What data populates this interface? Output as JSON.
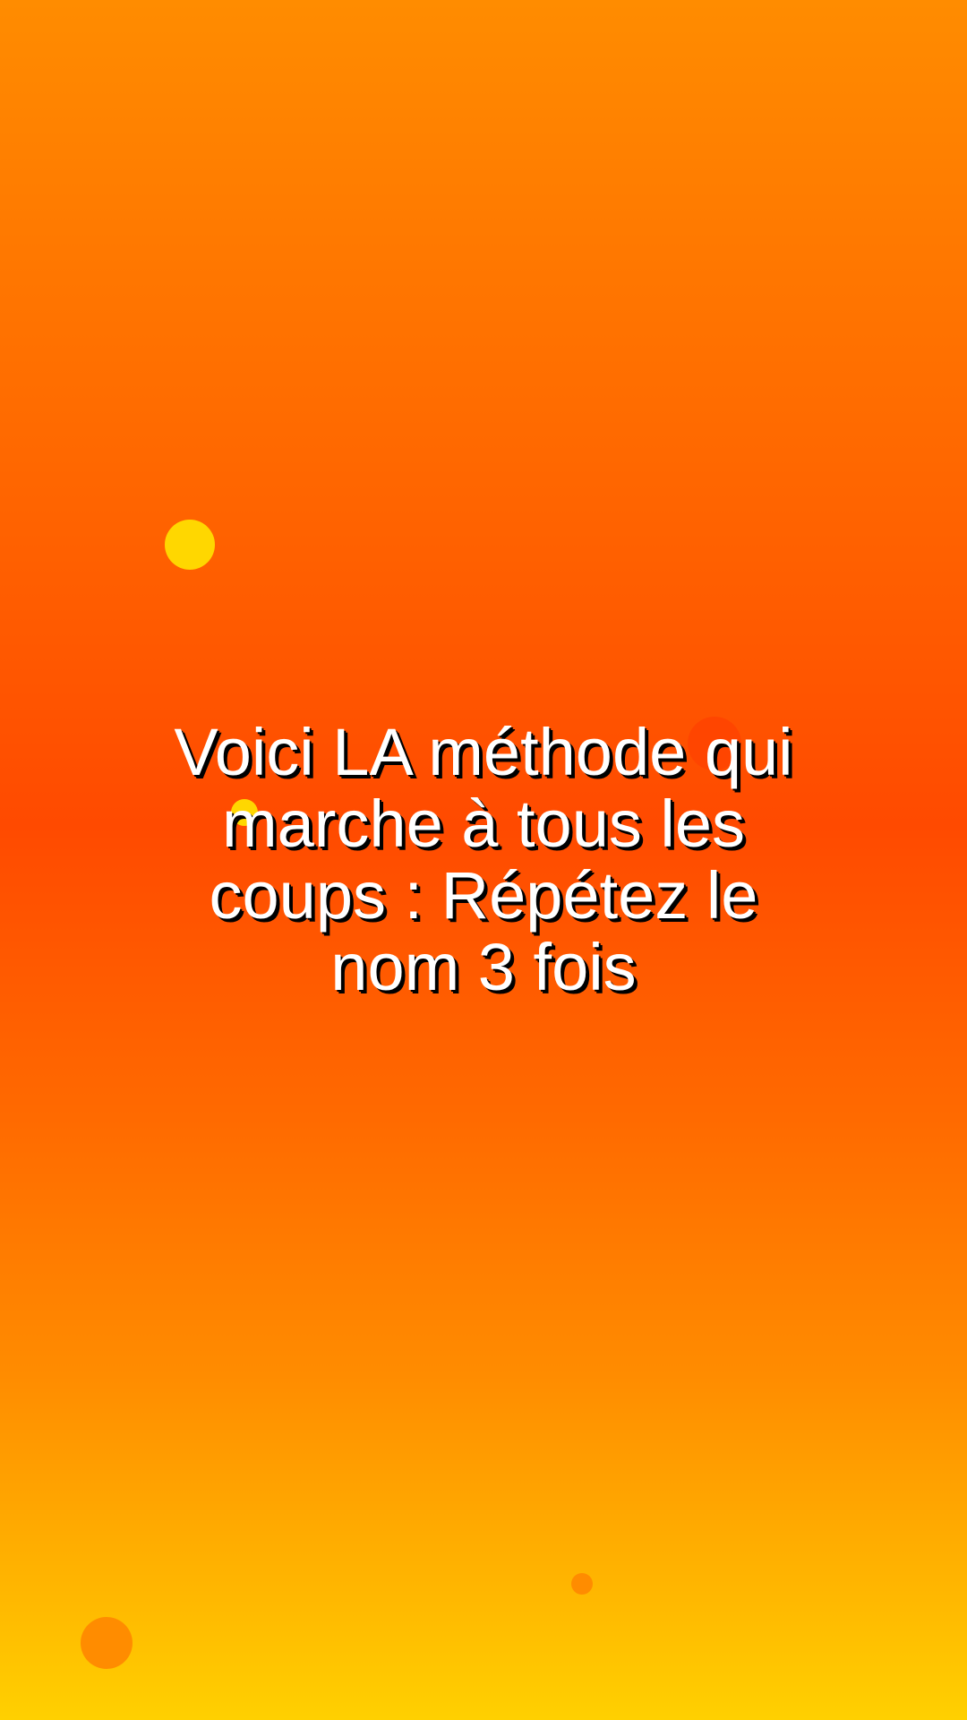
{
  "message": {
    "text": "Voici LA méthode qui marche à tous les coups : Répétez le nom 3 fois"
  },
  "colors": {
    "gradient_top": "#FF8C00",
    "gradient_middle": "#FF4A00",
    "gradient_bottom": "#FFD000",
    "dot_yellow": "#FFD700",
    "dot_red_orange": "#FF4500",
    "dot_orange": "#FF8C00",
    "text": "#FFFFFF",
    "text_shadow": "#000000"
  }
}
